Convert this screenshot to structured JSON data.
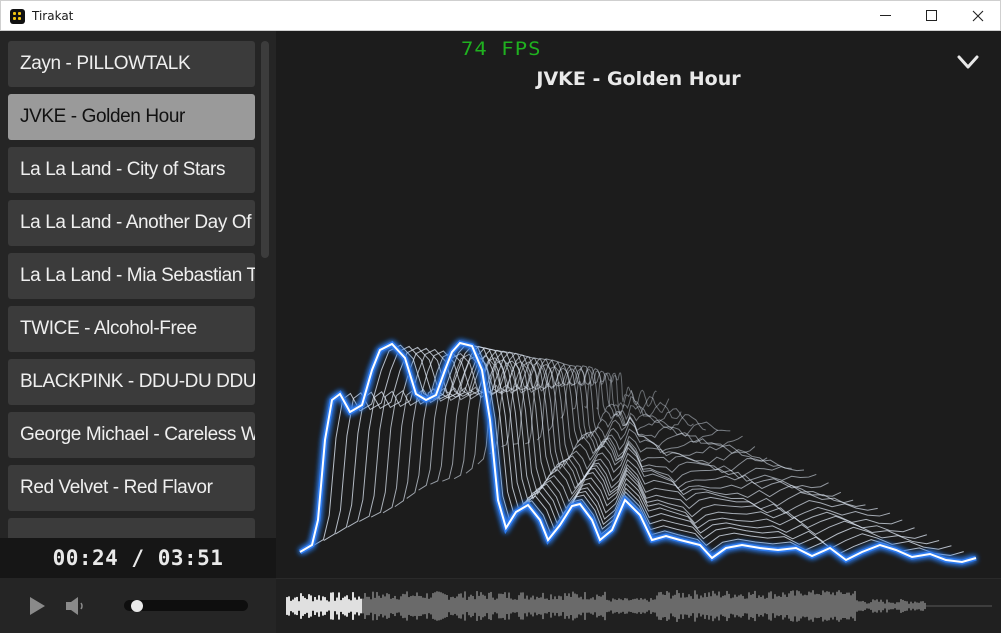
{
  "window": {
    "title": "Tirakat"
  },
  "playlist": [
    "Zayn - PILLOWTALK",
    "JVKE - Golden Hour",
    "La La Land - City of Stars",
    "La La Land - Another Day Of Sun",
    "La La Land - Mia Sebastian Theme",
    "TWICE - Alcohol-Free",
    "BLACKPINK - DDU-DU DDU-DU",
    "George Michael - Careless Whisper",
    "Red Velvet - Red Flavor",
    "..."
  ],
  "active_index": 1,
  "now_playing": {
    "title": "JVKE - Golden Hour",
    "fps": "74 FPS"
  },
  "playback": {
    "time": "00:24 / 03:51",
    "volume": 0.05
  },
  "colors": {
    "accent": "#3a8dff",
    "fps": "#1fb11f",
    "active_item": "#9a9a9a"
  }
}
